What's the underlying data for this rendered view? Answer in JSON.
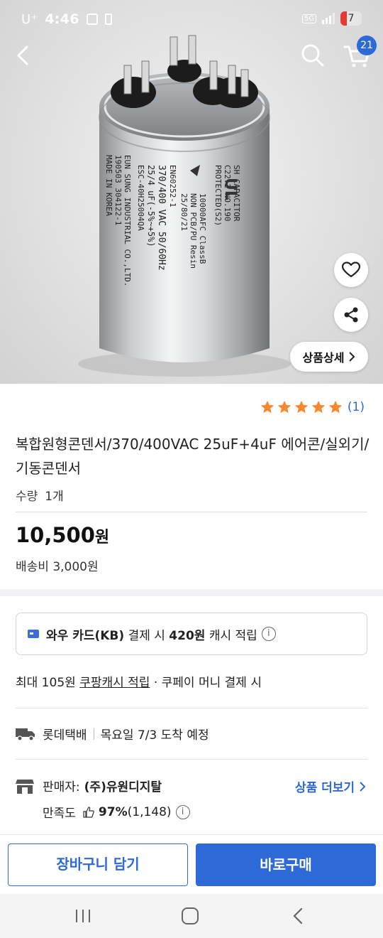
{
  "status_bar": {
    "carrier": "U⁺",
    "time": "4:46",
    "network": "5G",
    "battery": "7"
  },
  "header": {
    "cart_count": "21"
  },
  "image_overlay": {
    "detail_button_label": "상품상세"
  },
  "product": {
    "rating_count": "(1)",
    "rating_stars": 5,
    "title": "복합원형콘덴서/370/400VAC 25uF+4uF 에어콘/실외기/기동콘덴서",
    "quantity_label": "수량",
    "quantity_value": "1개",
    "price": "10,500",
    "price_unit": "원",
    "shipping": "배송비 3,000원"
  },
  "benefits": {
    "card_name": "와우 카드(KB)",
    "card_mid": "결제 시",
    "card_amount": "420원",
    "card_tail": "캐시 적립",
    "cash_prefix": "최대 105원",
    "cash_link": "쿠팡캐시 적립",
    "cash_suffix": "· 쿠페이 머니 결제 시"
  },
  "delivery": {
    "courier": "롯데택배",
    "eta": "목요일 7/3 도착 예정"
  },
  "seller": {
    "label": "판매자:",
    "name": "(주)유원디지탈",
    "more_link": "상품 더보기",
    "satisfaction_label": "만족도",
    "satisfaction_value": "97%",
    "satisfaction_count": "(1,148)"
  },
  "actions": {
    "add_to_cart": "장바구니 담기",
    "buy_now": "바로구매"
  },
  "product_image_text": [
    "SH CAPACITOR",
    "C22.2 NO.190",
    "PROTECTED(S2)",
    "10000AFC ClassB",
    "NON PCB/PU Resin",
    "25/80/21",
    "EN60252-1",
    "370/400 VAC 50/60Hz",
    "25/4 uF(-5%~+5%)",
    "ESC-40H25004QA",
    "EUN SUNG INDUSTRIAL CO.,LTD.",
    "190503 304122-1",
    "MADE IN KOREA"
  ],
  "colors": {
    "accent": "#2d6ad8",
    "star": "#f38a2f",
    "band": "#f1f2f4"
  }
}
